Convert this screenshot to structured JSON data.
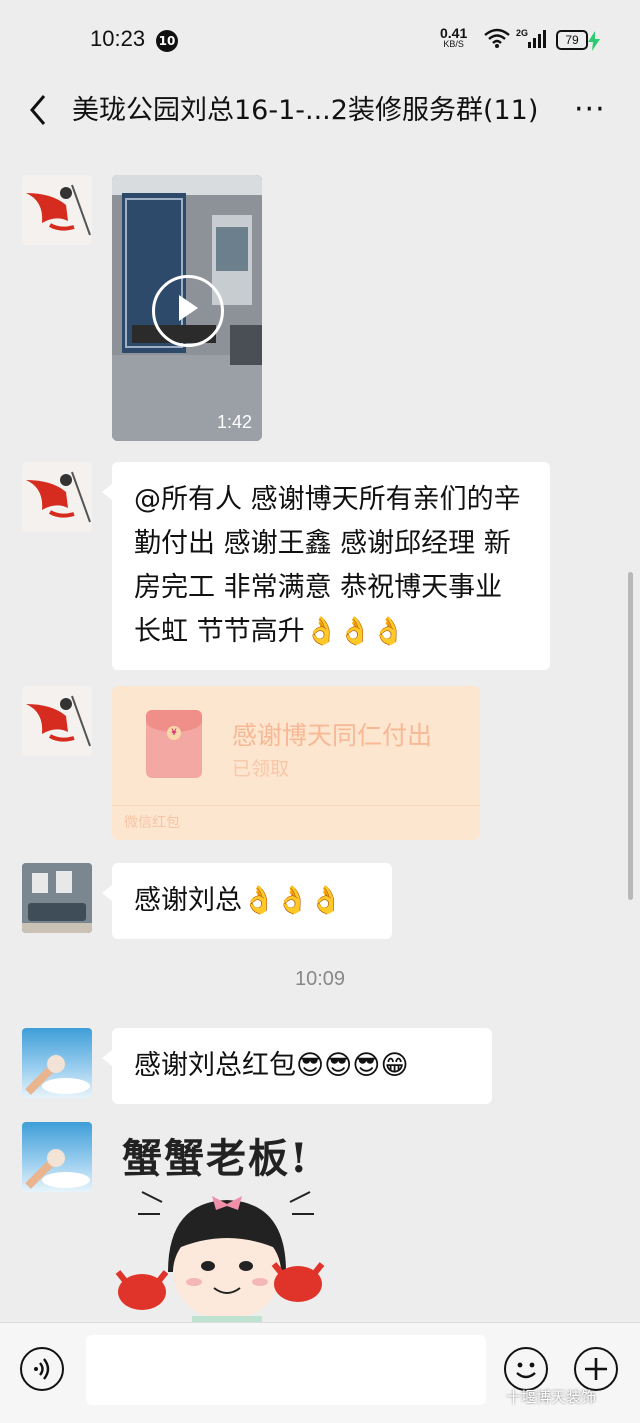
{
  "status_bar": {
    "time": "10:23",
    "notification_count": "10",
    "net_speed": "0.41",
    "net_unit": "KB/S",
    "network_type": "2G",
    "battery": "79",
    "icons": [
      "wifi-icon",
      "signal-icon",
      "charging-icon"
    ]
  },
  "header": {
    "back_icon": "chevron-left-icon",
    "title": "美珑公园刘总16-1-...2装修服务群(11)",
    "more": "···"
  },
  "messages": [
    {
      "type": "video",
      "duration": "1:42"
    },
    {
      "type": "text",
      "text": "@所有人  感谢博天所有亲们的辛勤付出 感谢王鑫  感谢邱经理 新房完工  非常满意  恭祝博天事业长虹 节节高升",
      "emoji": "👌👌👌"
    },
    {
      "type": "red_packet",
      "title": "感谢博天同仁付出",
      "status": "已领取",
      "footer": "微信红包"
    },
    {
      "type": "text",
      "text": "感谢刘总",
      "emoji": "👌👌👌"
    },
    {
      "type": "timestamp",
      "text": "10:09"
    },
    {
      "type": "text",
      "text": "感谢刘总红包",
      "emoji": "😎😎😎😁"
    },
    {
      "type": "sticker",
      "text": "蟹蟹老板!"
    }
  ],
  "input_bar": {
    "icons": [
      "voice-icon",
      "emoji-icon",
      "plus-icon"
    ]
  },
  "watermark": "十堰博天装饰",
  "colors": {
    "background": "#ededed",
    "bubble": "#ffffff",
    "red_packet": "#fde6cf"
  }
}
